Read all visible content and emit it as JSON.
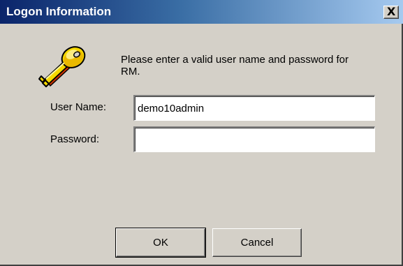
{
  "window": {
    "title": "Logon Information",
    "close_glyph": "X"
  },
  "icon": "key-icon",
  "message": "Please enter a valid user name and password for RM.",
  "fields": {
    "username": {
      "label": "User Name:",
      "value": "demo10admin",
      "placeholder": ""
    },
    "password": {
      "label": "Password:",
      "value": "",
      "placeholder": ""
    }
  },
  "buttons": {
    "ok": "OK",
    "cancel": "Cancel"
  },
  "colors": {
    "titlebar_start": "#0a246a",
    "titlebar_end": "#a6caf0",
    "dialog_face": "#d4d0c8",
    "key_gold": "#f5d800"
  }
}
